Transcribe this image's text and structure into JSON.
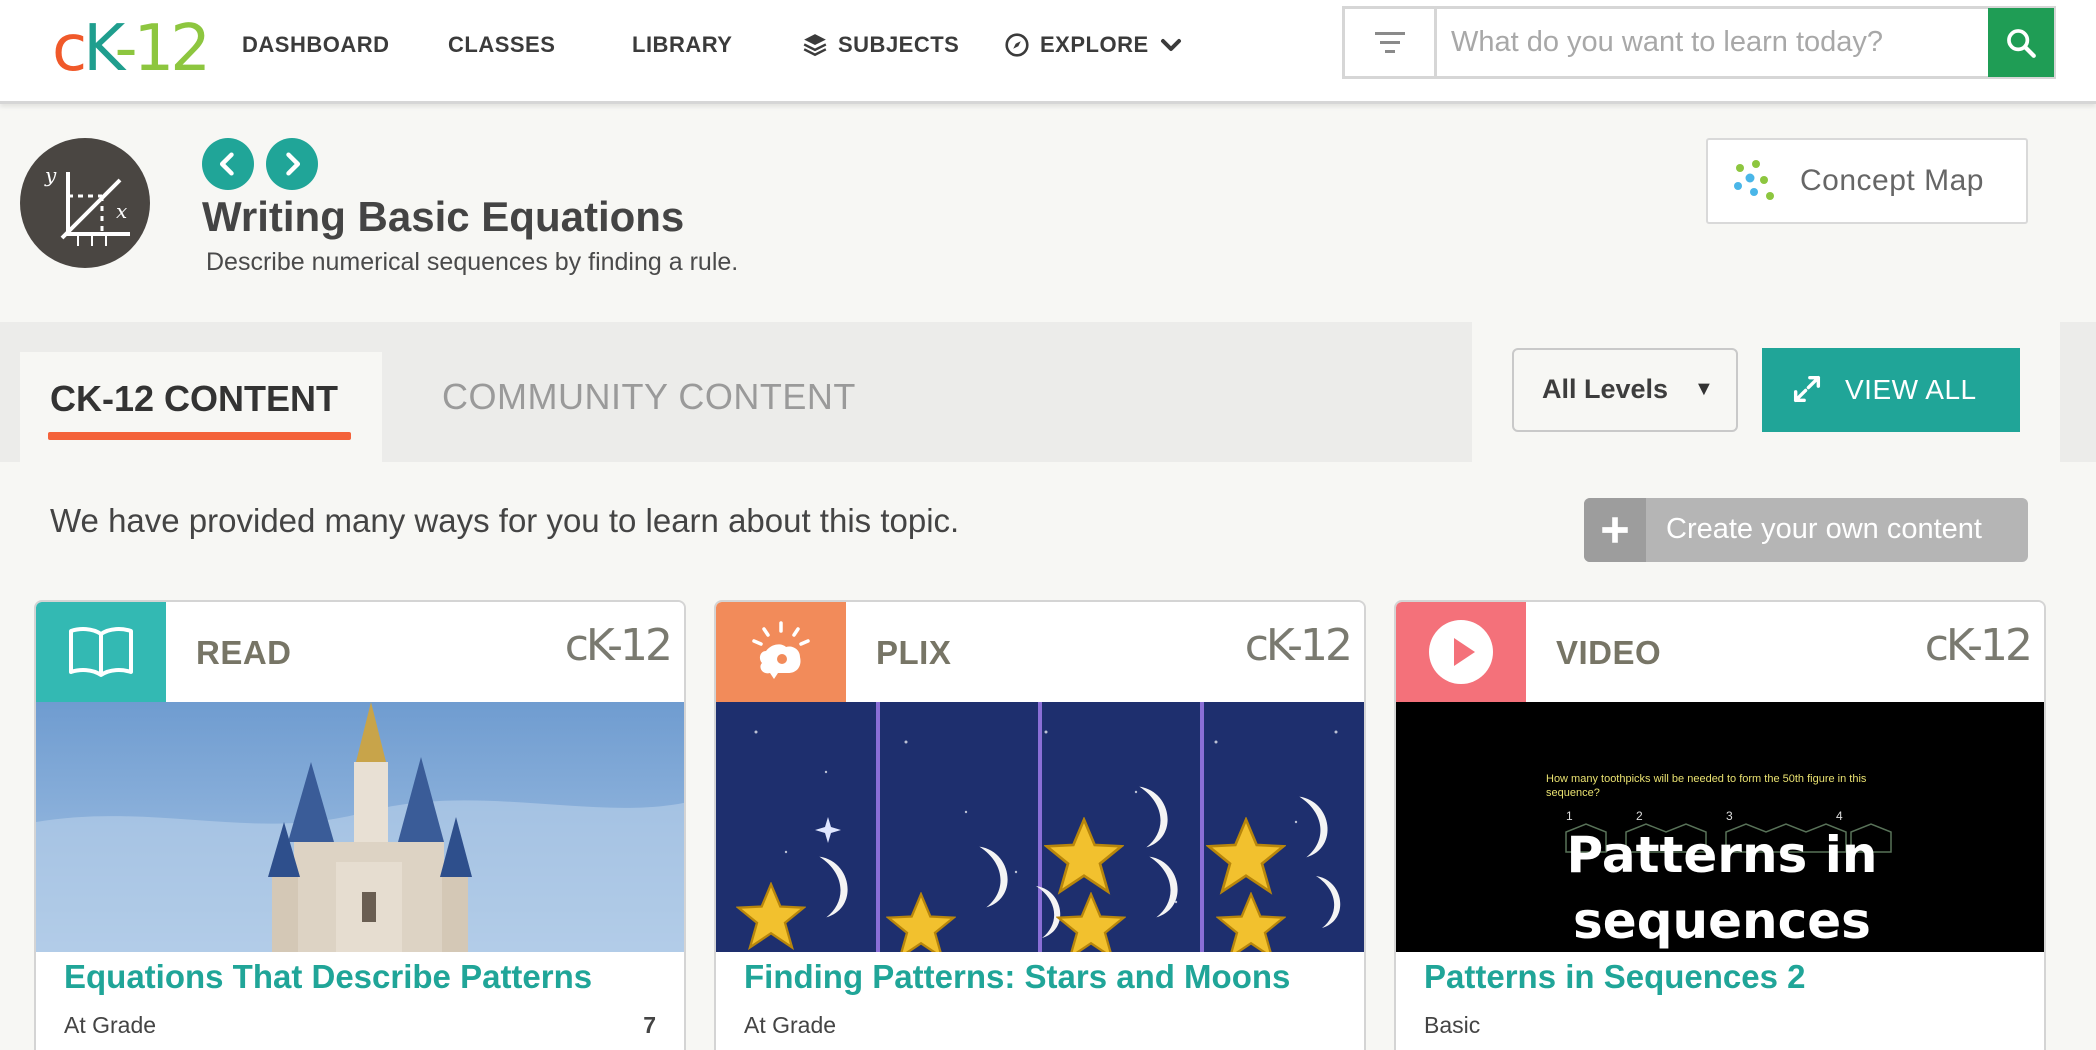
{
  "header": {
    "logo_text": {
      "c": "c",
      "k": "K",
      "n": "-12"
    },
    "nav": {
      "dashboard": "DASHBOARD",
      "classes": "CLASSES",
      "library": "LIBRARY",
      "subjects": "SUBJECTS",
      "explore": "EXPLORE"
    },
    "search": {
      "placeholder": "What do you want to learn today?",
      "value": ""
    }
  },
  "concept": {
    "title": "Writing Basic Equations",
    "subtitle": "Describe numerical sequences by finding a rule.",
    "concept_map_label": "Concept Map"
  },
  "tabs": {
    "active": "CK-12 CONTENT",
    "inactive": "COMMUNITY CONTENT"
  },
  "filters": {
    "levels_selected": "All Levels",
    "view_all_label": "VIEW ALL"
  },
  "intro": {
    "text": "We have provided many ways for you to learn about this topic.",
    "create_label": "Create your own content"
  },
  "cards": [
    {
      "type": "READ",
      "brand": "cK-12",
      "title": "Equations That Describe Patterns",
      "level": "At Grade",
      "count": "7",
      "color": "#33b9b3"
    },
    {
      "type": "PLIX",
      "brand": "cK-12",
      "title": "Finding Patterns: Stars and Moons",
      "level": "At Grade",
      "count": "",
      "color": "#f28b5a"
    },
    {
      "type": "VIDEO",
      "brand": "cK-12",
      "title": "Patterns in Sequences 2",
      "level": "Basic",
      "count": "",
      "color": "#f4717a",
      "video_question": "How many toothpicks will be needed to form the 50th figure in this sequence?",
      "video_numbers": [
        "1",
        "2",
        "3",
        "4"
      ],
      "video_overlay": "Patterns in sequences"
    }
  ],
  "colors": {
    "teal": "#20a598",
    "green": "#1f9d55",
    "orange": "#f4623a"
  }
}
